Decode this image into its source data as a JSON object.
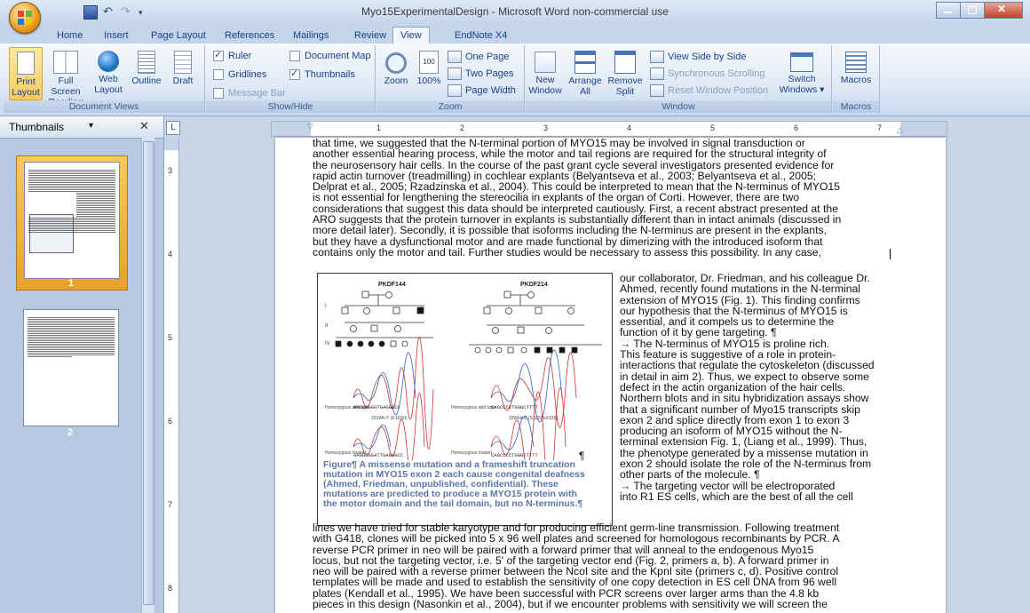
{
  "window": {
    "title": "Myo15ExperimentalDesign - Microsoft Word non-commercial use"
  },
  "tabs": [
    "Home",
    "Insert",
    "Page Layout",
    "References",
    "Mailings",
    "Review",
    "View",
    "EndNote X4"
  ],
  "active_tab": "View",
  "ribbon": {
    "document_views": {
      "label": "Document Views",
      "buttons": [
        "Print Layout",
        "Full Screen Reading",
        "Web Layout",
        "Outline",
        "Draft"
      ]
    },
    "show_hide": {
      "label": "Show/Hide",
      "ruler": "Ruler",
      "gridlines": "Gridlines",
      "message_bar": "Message Bar",
      "document_map": "Document Map",
      "thumbnails": "Thumbnails"
    },
    "zoom": {
      "label": "Zoom",
      "zoom_btn": "Zoom",
      "hundred": "100%",
      "one_page": "One Page",
      "two_pages": "Two Pages",
      "page_width": "Page Width"
    },
    "window": {
      "label": "Window",
      "new_window": "New Window",
      "arrange_all": "Arrange All",
      "remove_split": "Remove Split",
      "view_side": "View Side by Side",
      "sync_scroll": "Synchronous Scrolling",
      "reset_pos": "Reset Window Position",
      "switch_windows": "Switch Windows"
    },
    "macros": {
      "label": "Macros",
      "btn": "Macros"
    }
  },
  "thumbnails_pane": {
    "title": "Thumbnails",
    "page_numbers": [
      "1",
      "2"
    ]
  },
  "document": {
    "top_lines": [
      "that time, we suggested that the N-terminal portion of MYO15 may be involved in signal transduction or",
      "another essential hearing process, while the motor and tail regions are required for the structural integrity of",
      "the neurosensory hair cells. In the course of the past grant cycle several investigators presented evidence for",
      "rapid actin turnover (treadmilling) in cochlear explants (Belyantseva et al., 2003; Belyantseva et al., 2005;",
      "Delprat et al., 2005; Rzadzinska et al., 2004). This could be interpreted to mean that the N-terminus of MYO15",
      "is not essential for lengthening the stereocilia in explants of the organ of Corti. However, there are two",
      "considerations that suggest this data should be interpreted cautiously. First, a recent abstract presented at the",
      "ARO suggests that the protein turnover in explants is substantially different than in intact animals (discussed in",
      "more detail later). Secondly, it is possible that isoforms including the N-terminus are present in the explants,",
      "but they have a dysfunctional motor and are made functional by dimerizing with the introduced isoform that",
      "contains only the motor and tail. Further studies would be necessary to assess this possibility. In any case,"
    ],
    "side_lines": [
      "our collaborator, Dr. Friedman, and his colleague Dr.",
      "Ahmed, recently found mutations in the N-terminal",
      "extension of MYO15 (Fig. 1). This finding confirms",
      "our hypothesis that the N-terminus of MYO15 is",
      "essential, and it compels us to determine the",
      "function of it by gene targeting. ¶",
      "→ The N-terminus of MYO15 is proline rich.",
      "This feature is suggestive of a role in protein-",
      "interactions that regulate the cytoskeleton (discussed",
      "in detail in aim 2). Thus, we expect to observe some",
      "defect in the actin organization of the hair cells.",
      "Northern blots and in situ hybridization assays show",
      "that a significant number of Myo15 transcripts skip",
      "exon 2 and splice directly from exon 1 to exon 3",
      "producing an isoform of MYO15 without the N-",
      "terminal extension Fig. 1, (Liang et al., 1999). Thus,",
      "the phenotype generated by a missense mutation in",
      "exon 2 should isolate the role of the N-terminus from",
      "other parts of the molecule. ¶",
      "→ The targeting vector will be electroporated",
      "into R1 ES cells, which are the best of all the cell"
    ],
    "bottom_lines": [
      "lines we have tried for stable karyotype and for producing efficient germ-line transmission. Following treatment",
      "with G418, clones will be picked into 5 x 96 well plates and screened for homologous recombinants by PCR. A",
      "reverse PCR primer in neo will be paired with a forward primer that will anneal to the endogenous Myo15",
      "locus, but not the targeting vector, i.e. 5' of the targeting vector end (Fig. 2, primers a, b). A forward primer in",
      "neo will be paired with a reverse primer between the NcoI site and the KpnI site (primers c, d). Positive control",
      "templates will be made and used to establish the sensitivity of one copy detection in ES cell DNA from 96 well",
      "plates (Kendall et al., 1995). We have been successful with PCR screens over larger arms than the 4.8 kb",
      "pieces in this design (Nasonkin et al., 2004), but if we encounter problems with sensitivity we will screen the"
    ],
    "figure": {
      "label_left": "PKDF144",
      "label_right": "PKDF214",
      "mut_left": "2018A>T (E1105I)",
      "mut_right": "3266del5 (S1122fsX126)",
      "wt_label": "Homozygous wild type",
      "mut_label": "Homozygous mutant",
      "seq_left": "AAGGGGGGTGAGGGCC",
      "seq_right": "CAGCCCCTGGGCTTTT",
      "seq_left2": "AAGGGGGATTGAGGGCC",
      "seq_right2": "CAGCCCCTGGGCTTTT",
      "pilcrow": "¶",
      "caption": "Figure¶ A missense mutation and a frameshift truncation mutation in MYO15 exon 2 each cause congenital deafness (Ahmed, Friedman, unpublished, confidential). These mutations are predicted to produce a MYO15 protein with the motor domain and the tail domain, but no N-terminus.¶"
    },
    "ruler": {
      "h_numbers": [
        "1",
        "2",
        "3",
        "4",
        "5",
        "6",
        "7"
      ],
      "v_numbers": [
        "3",
        "4",
        "5",
        "6",
        "7",
        "8"
      ]
    }
  },
  "colors": {
    "ribbon_blue": "#c4d5ea",
    "text_blue": "#15428b",
    "active_orange": "#f8c95e",
    "caption_blue": "#5a76a8"
  }
}
